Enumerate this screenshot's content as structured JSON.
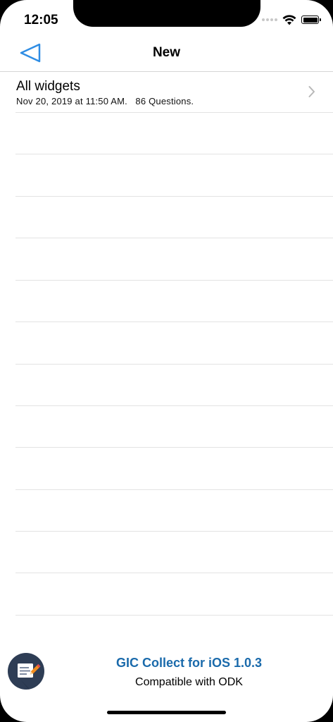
{
  "status_bar": {
    "time": "12:05",
    "icons": [
      "signal-dots-icon",
      "wifi-icon",
      "battery-icon"
    ]
  },
  "nav": {
    "title": "New",
    "back_icon": "back-triangle-icon",
    "accent_color": "#2f8de4"
  },
  "forms": [
    {
      "name": "All widgets",
      "meta": "Nov 20, 2019 at 11:50 AM.   86 Questions.",
      "icon": "chevron-right-icon"
    }
  ],
  "footer": {
    "title": "GIC Collect for iOS 1.0.3",
    "subtitle": "Compatible with ODK",
    "title_color": "#1a6aab",
    "fab_icon": "edit-form-icon"
  }
}
